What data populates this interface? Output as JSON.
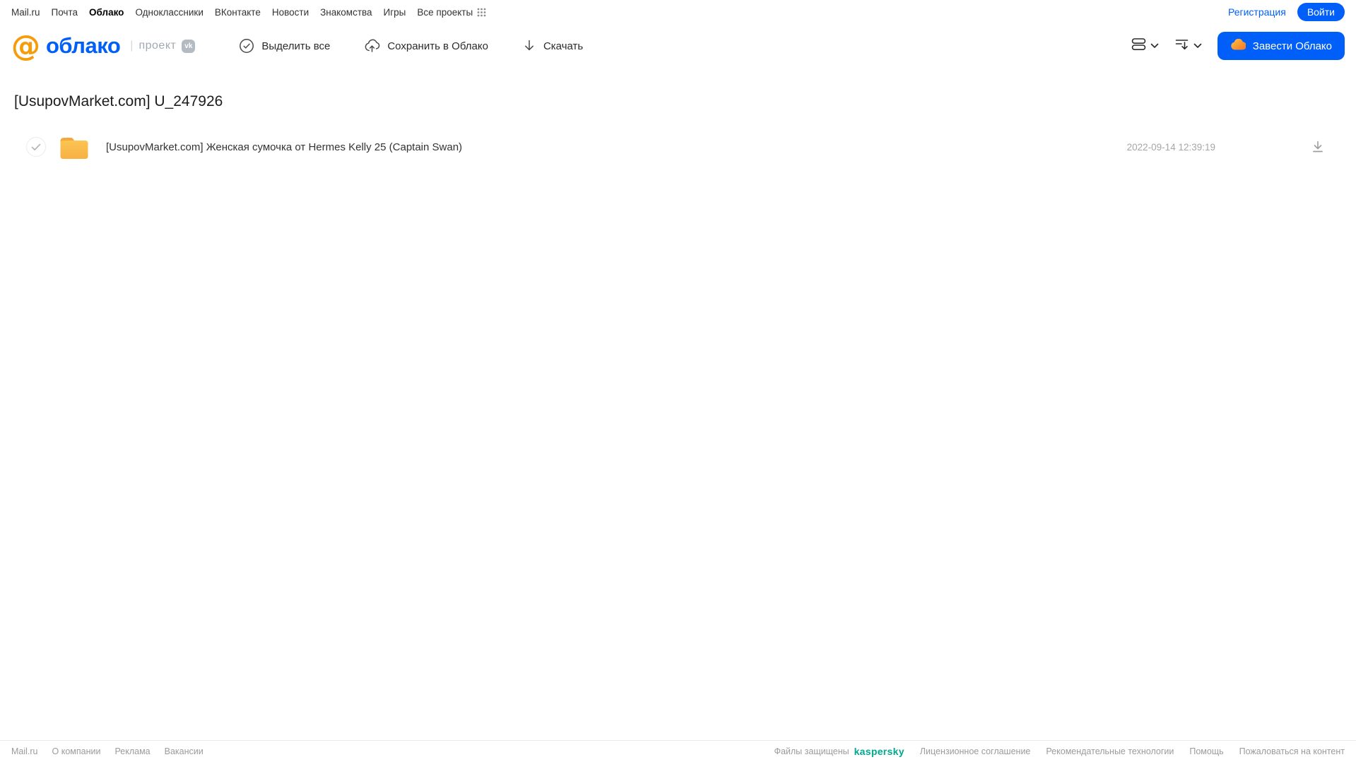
{
  "topbar": {
    "links": [
      "Mail.ru",
      "Почта",
      "Облако",
      "Одноклассники",
      "ВКонтакте",
      "Новости",
      "Знакомства",
      "Игры",
      "Все проекты"
    ],
    "register_label": "Регистрация",
    "login_label": "Войти"
  },
  "header": {
    "logo_at": "@",
    "logo_text": "облако",
    "project_separator": "|",
    "project_label": "проект",
    "vk_badge": "vk",
    "toolbar": {
      "select_all_label": "Выделить все",
      "save_to_cloud_label": "Сохранить в Облако",
      "download_label": "Скачать"
    },
    "get_cloud_label": "Завести Облако"
  },
  "page": {
    "title": "[UsupovMarket.com] U_247926"
  },
  "files": [
    {
      "type": "folder",
      "name": "[UsupovMarket.com] Женская сумочка от Hermes Kelly 25 (Captain Swan)",
      "date": "2022-09-14 12:39:19"
    }
  ],
  "footer": {
    "left_links": [
      "Mail.ru",
      "О компании",
      "Реклама",
      "Вакансии"
    ],
    "protected_label": "Файлы защищены",
    "kaspersky_label": "kaspersky",
    "right_links": [
      "Лицензионное соглашение",
      "Рекомендательные технологии",
      "Помощь",
      "Пожаловаться на контент"
    ]
  },
  "colors": {
    "brand_blue": "#005FF9",
    "logo_orange": "#F79C08",
    "folder_yellow": "#FABD4D",
    "kaspersky_green": "#00A88E"
  }
}
